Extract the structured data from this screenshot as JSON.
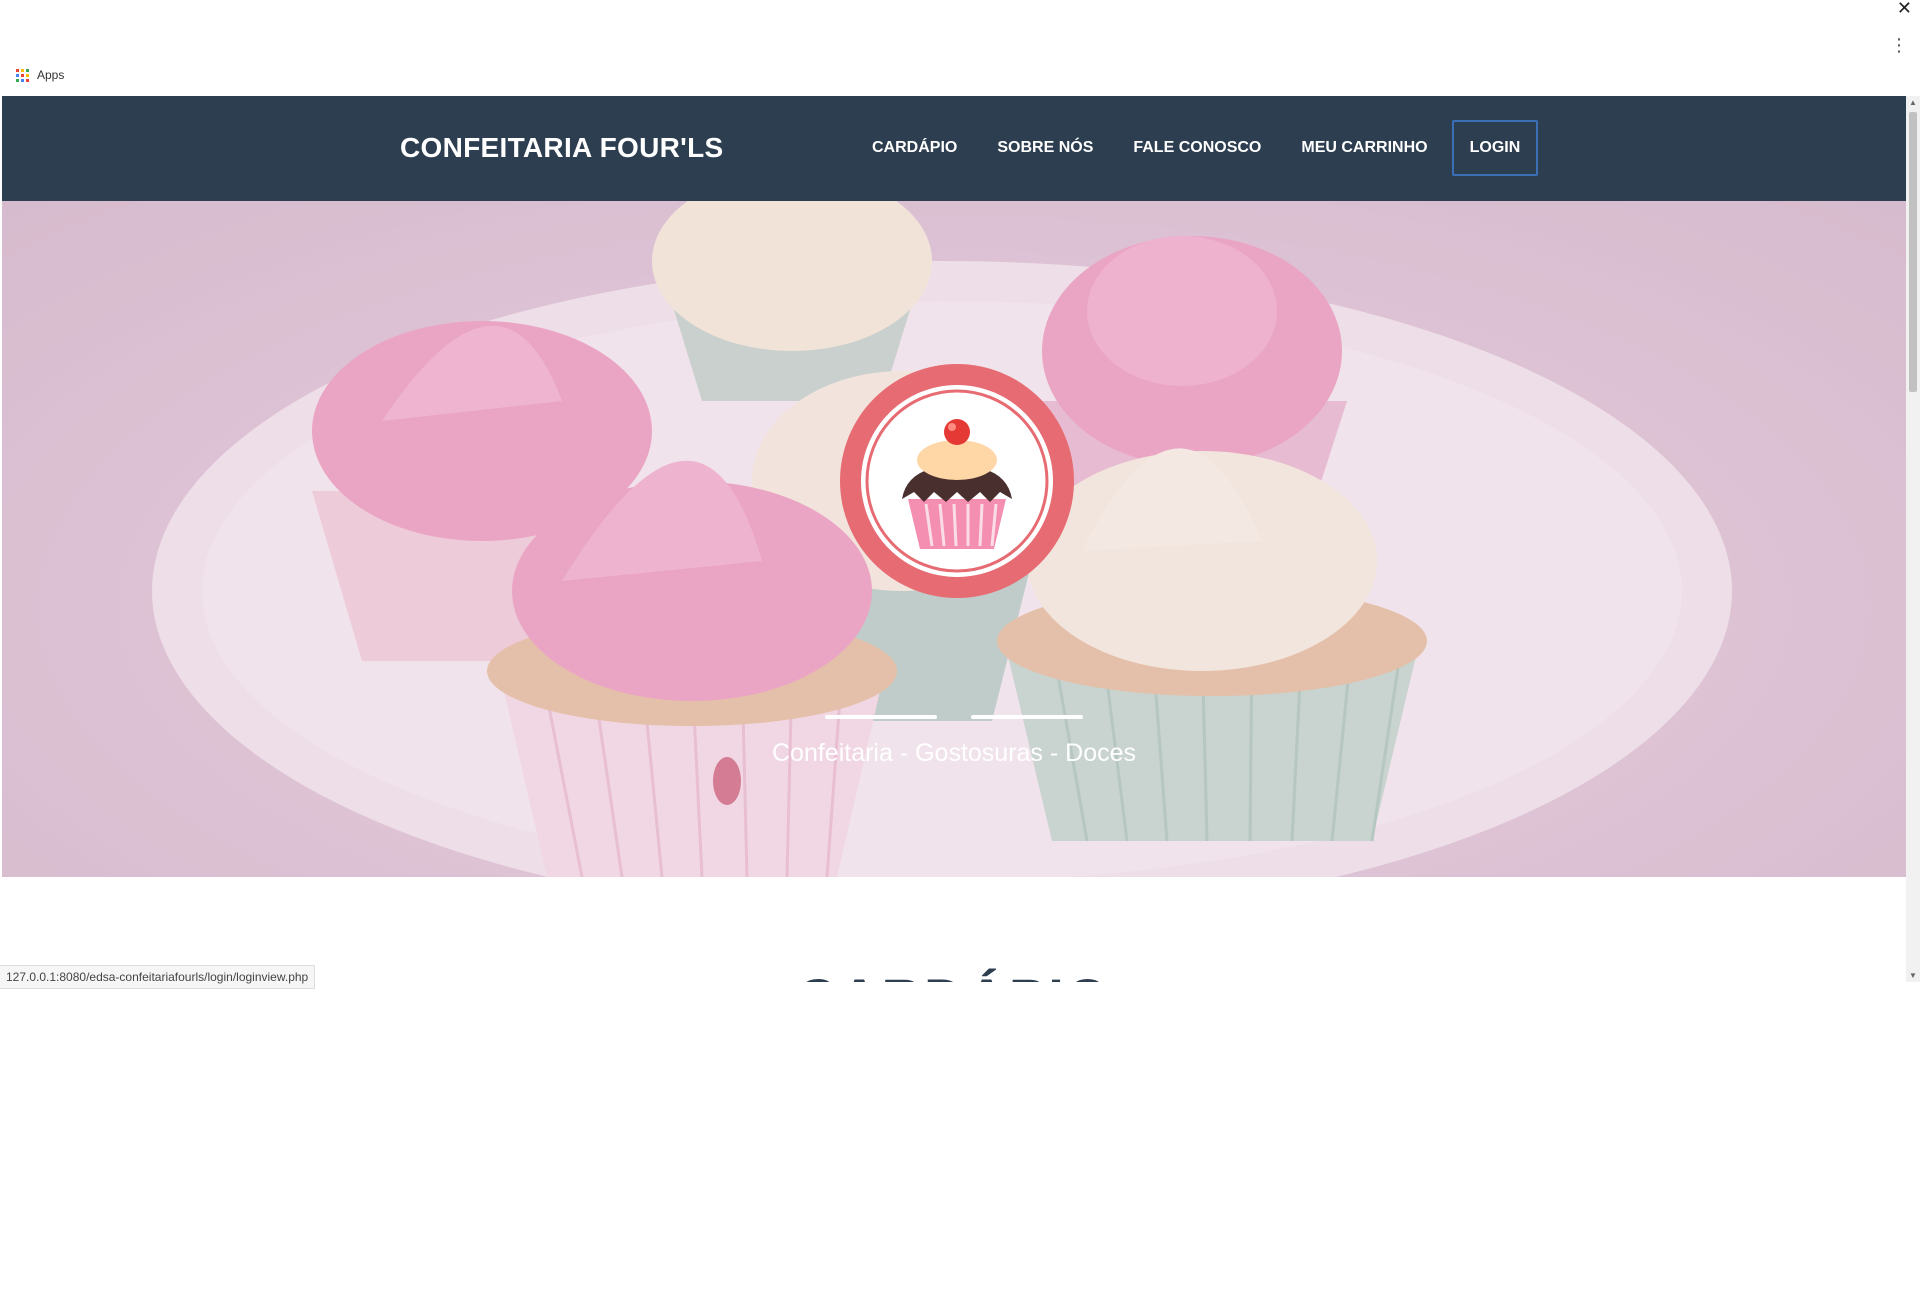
{
  "browser": {
    "close_glyph": "✕",
    "menu_glyph": "⋮",
    "bookmarks": {
      "apps_label": "Apps",
      "apps_icon": "apps-grid-icon"
    },
    "status_url": "127.0.0.1:8080/edsa-confeitariafourls/login/loginview.php"
  },
  "navbar": {
    "brand": "CONFEITARIA FOUR'LS",
    "items": [
      "CARDÁPIO",
      "SOBRE NÓS",
      "FALE CONOSCO",
      "MEU CARRINHO"
    ],
    "login": "LOGIN",
    "colors": {
      "background": "#2c3e50",
      "login_border": "#3b6fb6"
    }
  },
  "hero": {
    "tagline": "Confeitaria - Gostosuras - Doces",
    "logo_icon": "cupcake-logo-icon",
    "colors": {
      "logo_ring": "#e76b72",
      "overlay": "#e8cdde"
    }
  },
  "section": {
    "title": "CARDÁPIO"
  }
}
